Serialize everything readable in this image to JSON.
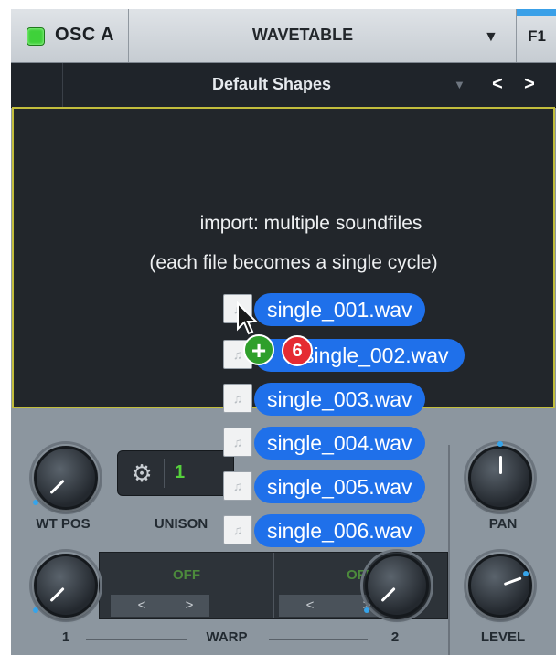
{
  "header": {
    "osc_label": "OSC A",
    "wavetable_name": "WAVETABLE",
    "dropdown_glyph": "▼",
    "filter_button": "F1"
  },
  "browser": {
    "category": "Default Shapes",
    "dropdown_glyph": "▼",
    "prev": "<",
    "next": ">"
  },
  "display": {
    "line1": "import: multiple soundfiles",
    "line2": "(each file becomes a single cycle)"
  },
  "controls": {
    "wt_pos": "WT POS",
    "unison": "UNISON",
    "unison_value": "1",
    "pan": "PAN",
    "level": "LEVEL",
    "warp_label": "WARP",
    "warp_1_num": "1",
    "warp_2_num": "2",
    "warp_1_value": "OFF",
    "warp_2_value": "OFF",
    "arrow_left": "<",
    "arrow_right": ">"
  },
  "drag": {
    "count": "6",
    "add_glyph": "+",
    "files": [
      "single_001.wav",
      "single_002.wav",
      "single_003.wav",
      "single_004.wav",
      "single_005.wav",
      "single_006.wav"
    ]
  },
  "colors": {
    "led": "#3fd13a",
    "display_border": "#c2bd3c",
    "accent": "#36a4ea",
    "pill": "#1f70ea",
    "count_badge": "#e52b32",
    "add_badge": "#2f9f2b"
  }
}
